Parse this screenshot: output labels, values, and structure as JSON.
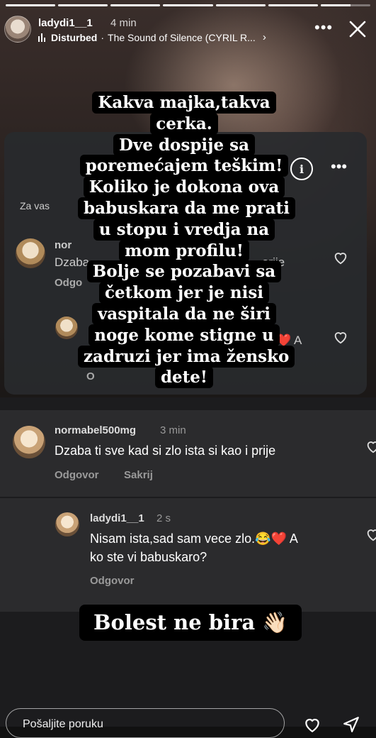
{
  "story": {
    "progress": [
      1,
      1,
      1,
      1,
      1,
      1,
      0.6
    ],
    "username": "ladydi1__1",
    "time": "4 min",
    "music_artist": "Disturbed",
    "music_sep": "·",
    "music_track": "The Sound of Silence (CYRIL R...",
    "more_icon": "more-horizontal-icon",
    "close_icon": "close-icon"
  },
  "background_screenshot": {
    "sort_label": "Za vas",
    "ghost_user": "nor",
    "ghost_text": "Dzaba",
    "ghost_text_end": "orije",
    "ghost_action": "Odgo",
    "ghost_reply_end": "A",
    "ghost_action2": "O"
  },
  "overlay_text": "Kakva majka,takva cerka.\nDve dospije sa poremećajem teškim!\nKoliko je dokona ova babuskara da me prati u stopu i vredja na mom profilu!\nBolje se pozabavi sa četkom jer je nisi vaspitala da ne širi noge kome stigne u zadruzi jer ima žensko dete!",
  "comments": [
    {
      "username": "normabel500mg",
      "time": "3 min",
      "text": "Dzaba ti sve kad si zlo ista si kao i prije",
      "action_reply": "Odgovor",
      "action_hide": "Sakrij"
    },
    {
      "username": "ladydi1__1",
      "time": "2 s",
      "text_line1": "Nisam ista,sad sam vece zlo.😂❤️ A",
      "text_line2": "ko ste vi babuskaro?",
      "action_reply": "Odgovor"
    }
  ],
  "bottom_label": "Bolest ne bira 👋🏻",
  "reply_placeholder": "Pošaljite poruku"
}
